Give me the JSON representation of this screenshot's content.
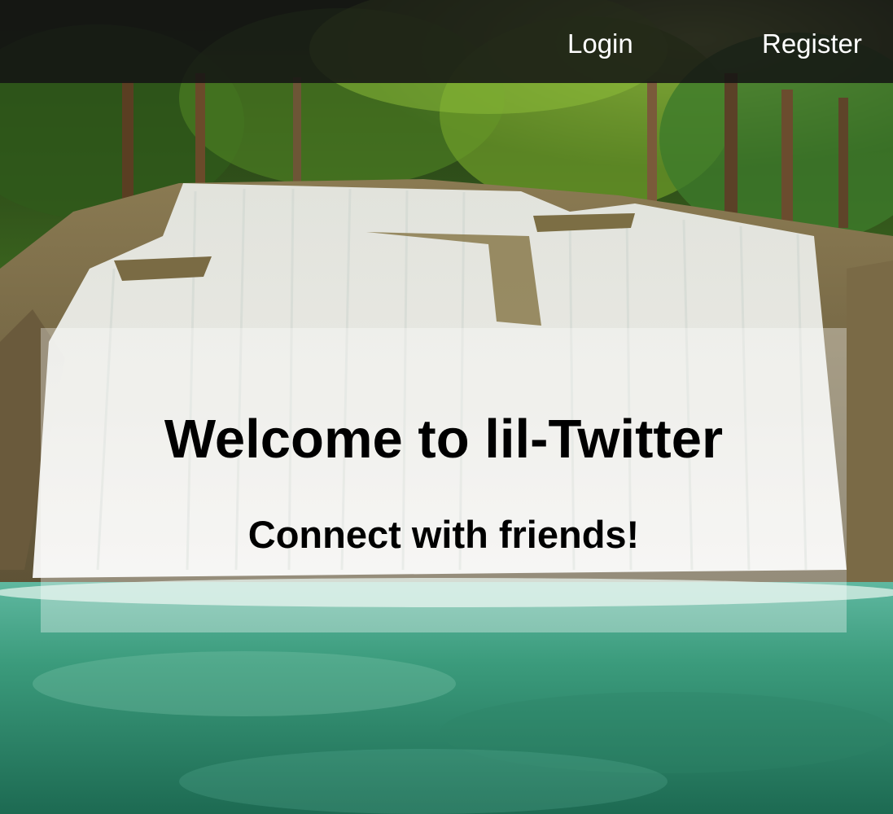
{
  "nav": {
    "login_label": "Login",
    "register_label": "Register"
  },
  "hero": {
    "title": "Welcome to lil-Twitter",
    "subtitle": "Connect with friends!",
    "background": "waterfall-forest-photo"
  },
  "colors": {
    "navbar": "#141414",
    "nav_text": "#ffffff",
    "panel": "#ffffff",
    "heading_text": "#000000"
  }
}
